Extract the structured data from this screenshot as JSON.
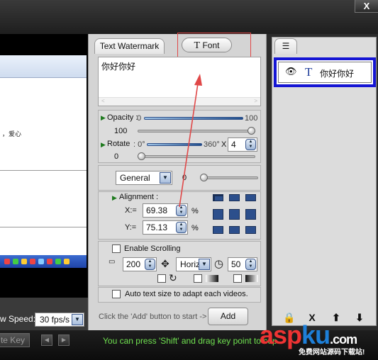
{
  "window": {
    "close_label": "X"
  },
  "preview": {
    "sample_text": "，爱心"
  },
  "playback": {
    "speed_label": "w Speed:",
    "speed_value": "30 fps/s"
  },
  "keyframes": {
    "delete_key_label": "te Key",
    "hint": "You can press 'Shift' and drag key point to cop"
  },
  "tabs": {
    "text_watermark": "Text Watermark",
    "font_t": "T",
    "font_label": "Font"
  },
  "text_input": {
    "value": "你好你好"
  },
  "opacity": {
    "label": "Opacity :",
    "min": "0",
    "max": "100",
    "value": "100",
    "level": 1.0
  },
  "rotate": {
    "label": "Rotate",
    "min": ": 0°",
    "max": "360°",
    "multiplier_label": "X",
    "multiplier_value": "4",
    "value": "0",
    "level": 0.0
  },
  "style": {
    "selected": "General",
    "value": "0"
  },
  "position": {
    "label": "Alignment :",
    "x_label": "X:=",
    "x_value": "69.38",
    "x_unit": "%",
    "y_label": "Y:=",
    "y_value": "75.13",
    "y_unit": "%"
  },
  "scrolling": {
    "enable_label": "Enable Scrolling",
    "speed_value": "200",
    "direction": "Horiz",
    "delay_value": "50"
  },
  "autosize": {
    "label": "Auto text size to adapt each videos."
  },
  "footer": {
    "start_hint": "Click the 'Add' button to start ->",
    "add_label": "Add"
  },
  "layers": {
    "item_t": "T",
    "item_label": "你好你好",
    "tools": [
      "X"
    ]
  },
  "watermark": {
    "logo_a": "asp",
    "logo_b": "ku",
    "logo_c": ".com",
    "subtitle": "免费网站源码下载站!"
  },
  "colors": {
    "accent_blue": "#1515d4",
    "hint_green": "#6fe04f",
    "highlight_red": "#e04848"
  }
}
